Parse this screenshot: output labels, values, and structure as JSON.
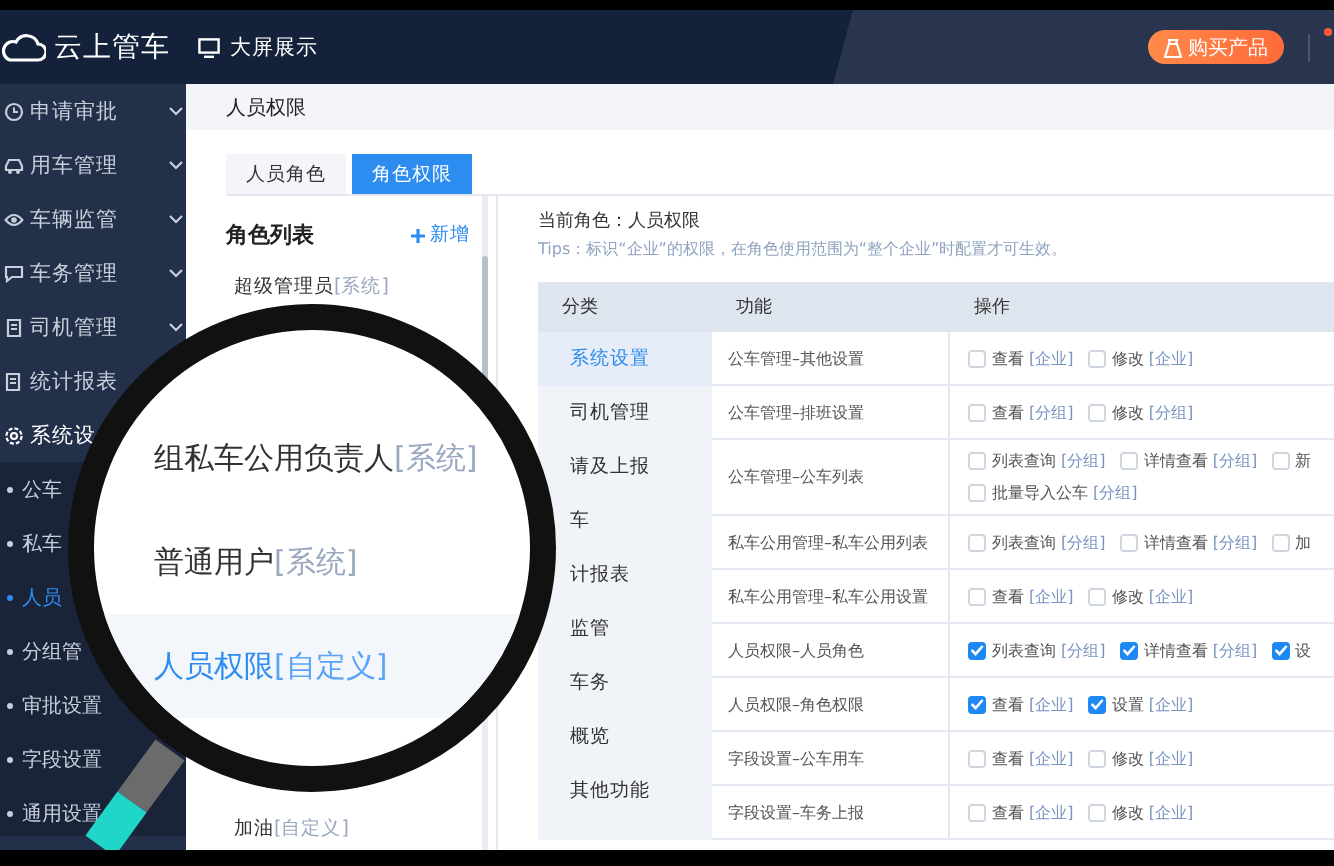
{
  "header": {
    "logo": "云上管车",
    "screen_link": "大屏展示",
    "buy_button": "购买产品"
  },
  "sidebar": {
    "items": [
      {
        "label": "申请审批",
        "kind": "group"
      },
      {
        "label": "用车管理",
        "kind": "group"
      },
      {
        "label": "车辆监管",
        "kind": "group"
      },
      {
        "label": "车务管理",
        "kind": "group"
      },
      {
        "label": "司机管理",
        "kind": "group"
      },
      {
        "label": "统计报表",
        "kind": "link"
      },
      {
        "label": "系统设",
        "kind": "link",
        "children": [
          {
            "label": "公车",
            "selected": false
          },
          {
            "label": "私车",
            "selected": false
          },
          {
            "label": "人员",
            "selected": true
          },
          {
            "label": "分组管",
            "selected": false
          },
          {
            "label": "审批设置",
            "selected": false
          },
          {
            "label": "字段设置",
            "selected": false
          },
          {
            "label": "通用设置",
            "selected": false
          }
        ]
      }
    ]
  },
  "breadcrumb": "人员权限",
  "tabs": [
    {
      "label": "人员角色",
      "selected": false
    },
    {
      "label": "角色权限",
      "selected": true
    }
  ],
  "role_list": {
    "title": "角色列表",
    "add_button": "新增",
    "items": [
      {
        "label": "超级管理员",
        "tag": "[系统]",
        "selected": false
      },
      {
        "label": "加油",
        "tag": "[自定义]",
        "selected": false
      }
    ]
  },
  "current_role": "当前角色：人员权限",
  "tips": "Tips：标识“企业”的权限，在角色使用范围为“整个企业”时配置才可生效。",
  "table": {
    "columns": [
      "分类",
      "功能",
      "操作"
    ],
    "categories": [
      {
        "label": "系统设置",
        "selected": true
      },
      {
        "label": "司机管理",
        "selected": false
      },
      {
        "label": "请及上报",
        "selected": false
      },
      {
        "label": "车",
        "selected": false
      },
      {
        "label": "计报表",
        "selected": false
      },
      {
        "label": "监管",
        "selected": false
      },
      {
        "label": "车务",
        "selected": false
      },
      {
        "label": "概览",
        "selected": false
      },
      {
        "label": "其他功能",
        "selected": false
      }
    ],
    "rows": [
      {
        "function": "公车管理–其他设置",
        "ops": [
          {
            "label": "查看",
            "scope": "[企业]",
            "checked": false
          },
          {
            "label": "修改",
            "scope": "[企业]",
            "checked": false
          }
        ]
      },
      {
        "function": "公车管理–排班设置",
        "ops": [
          {
            "label": "查看",
            "scope": "[分组]",
            "checked": false
          },
          {
            "label": "修改",
            "scope": "[分组]",
            "checked": false
          }
        ]
      },
      {
        "function": "公车管理–公车列表",
        "ops": [
          {
            "label": "列表查询",
            "scope": "[分组]",
            "checked": false
          },
          {
            "label": "详情查看",
            "scope": "[分组]",
            "checked": false
          },
          {
            "label": "新",
            "checked": false
          },
          {
            "label": "批量导入公车",
            "scope": "[分组]",
            "checked": false
          }
        ]
      },
      {
        "function": "私车公用管理–私车公用列表",
        "ops": [
          {
            "label": "列表查询",
            "scope": "[分组]",
            "checked": false
          },
          {
            "label": "详情查看",
            "scope": "[分组]",
            "checked": false
          },
          {
            "label": "加",
            "checked": false
          }
        ]
      },
      {
        "function": "私车公用管理–私车公用设置",
        "ops": [
          {
            "label": "查看",
            "scope": "[企业]",
            "checked": false
          },
          {
            "label": "修改",
            "scope": "[企业]",
            "checked": false
          }
        ]
      },
      {
        "function": "人员权限–人员角色",
        "ops": [
          {
            "label": "列表查询",
            "scope": "[分组]",
            "checked": true
          },
          {
            "label": "详情查看",
            "scope": "[分组]",
            "checked": true
          },
          {
            "label": "设",
            "checked": true
          }
        ]
      },
      {
        "function": "人员权限–角色权限",
        "ops": [
          {
            "label": "查看",
            "scope": "[企业]",
            "checked": true
          },
          {
            "label": "设置",
            "scope": "[企业]",
            "checked": true
          }
        ]
      },
      {
        "function": "字段设置–公车用车",
        "ops": [
          {
            "label": "查看",
            "scope": "[企业]",
            "checked": false
          },
          {
            "label": "修改",
            "scope": "[企业]",
            "checked": false
          }
        ]
      },
      {
        "function": "字段设置–车务上报",
        "ops": [
          {
            "label": "查看",
            "scope": "[企业]",
            "checked": false
          },
          {
            "label": "修改",
            "scope": "[企业]",
            "checked": false
          }
        ]
      }
    ]
  },
  "magnifier": {
    "items": [
      {
        "label": "组私车公用负责人",
        "tag": "[系统]",
        "selected": false
      },
      {
        "label": "普通用户",
        "tag": "[系统]",
        "selected": false
      },
      {
        "label": "人员权限",
        "tag": "[自定义]",
        "selected": true
      }
    ]
  }
}
